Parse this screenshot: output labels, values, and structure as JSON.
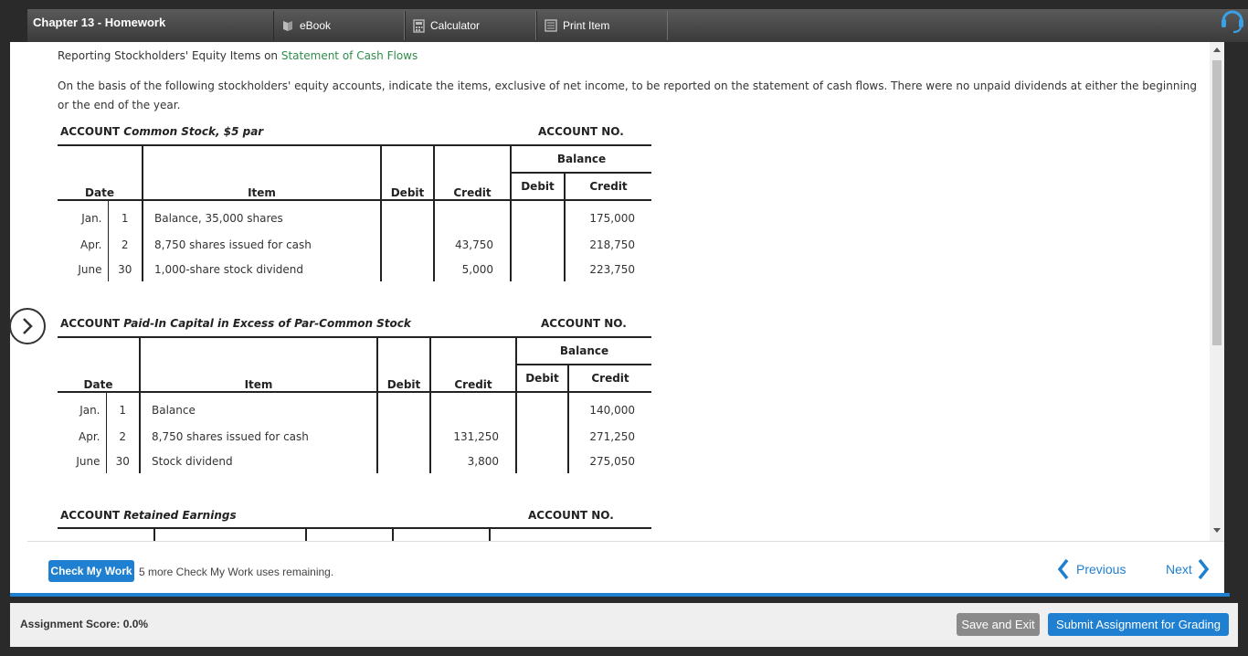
{
  "header": {
    "chapter_title": "Chapter 13 - Homework",
    "tabs": [
      {
        "label": "eBook",
        "icon": "book-icon"
      },
      {
        "label": "Calculator",
        "icon": "calculator-icon"
      },
      {
        "label": "Print Item",
        "icon": "print-icon"
      }
    ]
  },
  "problem": {
    "heading_prefix": "Reporting Stockholders' Equity Items on ",
    "heading_link": "Statement of Cash Flows",
    "instructions": "On the basis of the following stockholders' equity accounts, indicate the items, exclusive of net income, to be reported on the statement of cash flows. There were no unpaid dividends at either the beginning or the end of the year."
  },
  "accounts": [
    {
      "label": "ACCOUNT",
      "name": "Common Stock, $5 par",
      "acct_no_label": "ACCOUNT NO.",
      "headers": {
        "date": "Date",
        "item": "Item",
        "debit": "Debit",
        "credit": "Credit",
        "balance": "Balance",
        "bal_debit": "Debit",
        "bal_credit": "Credit"
      },
      "rows": [
        {
          "month": "Jan.",
          "day": "1",
          "item": "Balance, 35,000 shares",
          "debit": "",
          "credit": "",
          "bal_debit": "",
          "bal_credit": "175,000"
        },
        {
          "month": "Apr.",
          "day": "2",
          "item": "8,750 shares issued for cash",
          "debit": "",
          "credit": "43,750",
          "bal_debit": "",
          "bal_credit": "218,750"
        },
        {
          "month": "June",
          "day": "30",
          "item": "1,000-share stock dividend",
          "debit": "",
          "credit": "5,000",
          "bal_debit": "",
          "bal_credit": "223,750"
        }
      ]
    },
    {
      "label": "ACCOUNT",
      "name": "Paid-In Capital in Excess of Par-Common Stock",
      "acct_no_label": "ACCOUNT NO.",
      "headers": {
        "date": "Date",
        "item": "Item",
        "debit": "Debit",
        "credit": "Credit",
        "balance": "Balance",
        "bal_debit": "Debit",
        "bal_credit": "Credit"
      },
      "rows": [
        {
          "month": "Jan.",
          "day": "1",
          "item": "Balance",
          "debit": "",
          "credit": "",
          "bal_debit": "",
          "bal_credit": "140,000"
        },
        {
          "month": "Apr.",
          "day": "2",
          "item": "8,750 shares issued for cash",
          "debit": "",
          "credit": "131,250",
          "bal_debit": "",
          "bal_credit": "271,250"
        },
        {
          "month": "June",
          "day": "30",
          "item": "Stock dividend",
          "debit": "",
          "credit": "3,800",
          "bal_debit": "",
          "bal_credit": "275,050"
        }
      ]
    },
    {
      "label": "ACCOUNT",
      "name": "Retained Earnings",
      "acct_no_label": "ACCOUNT NO."
    }
  ],
  "bottom": {
    "check_label": "Check My Work",
    "remaining_text": "5 more Check My Work uses remaining.",
    "previous_label": "Previous",
    "next_label": "Next"
  },
  "footer": {
    "score_text": "Assignment Score: 0.0%",
    "save_label": "Save and Exit",
    "submit_label": "Submit Assignment for Grading"
  },
  "colors": {
    "accent": "#1f7fd0",
    "link": "#2f8c4c"
  }
}
